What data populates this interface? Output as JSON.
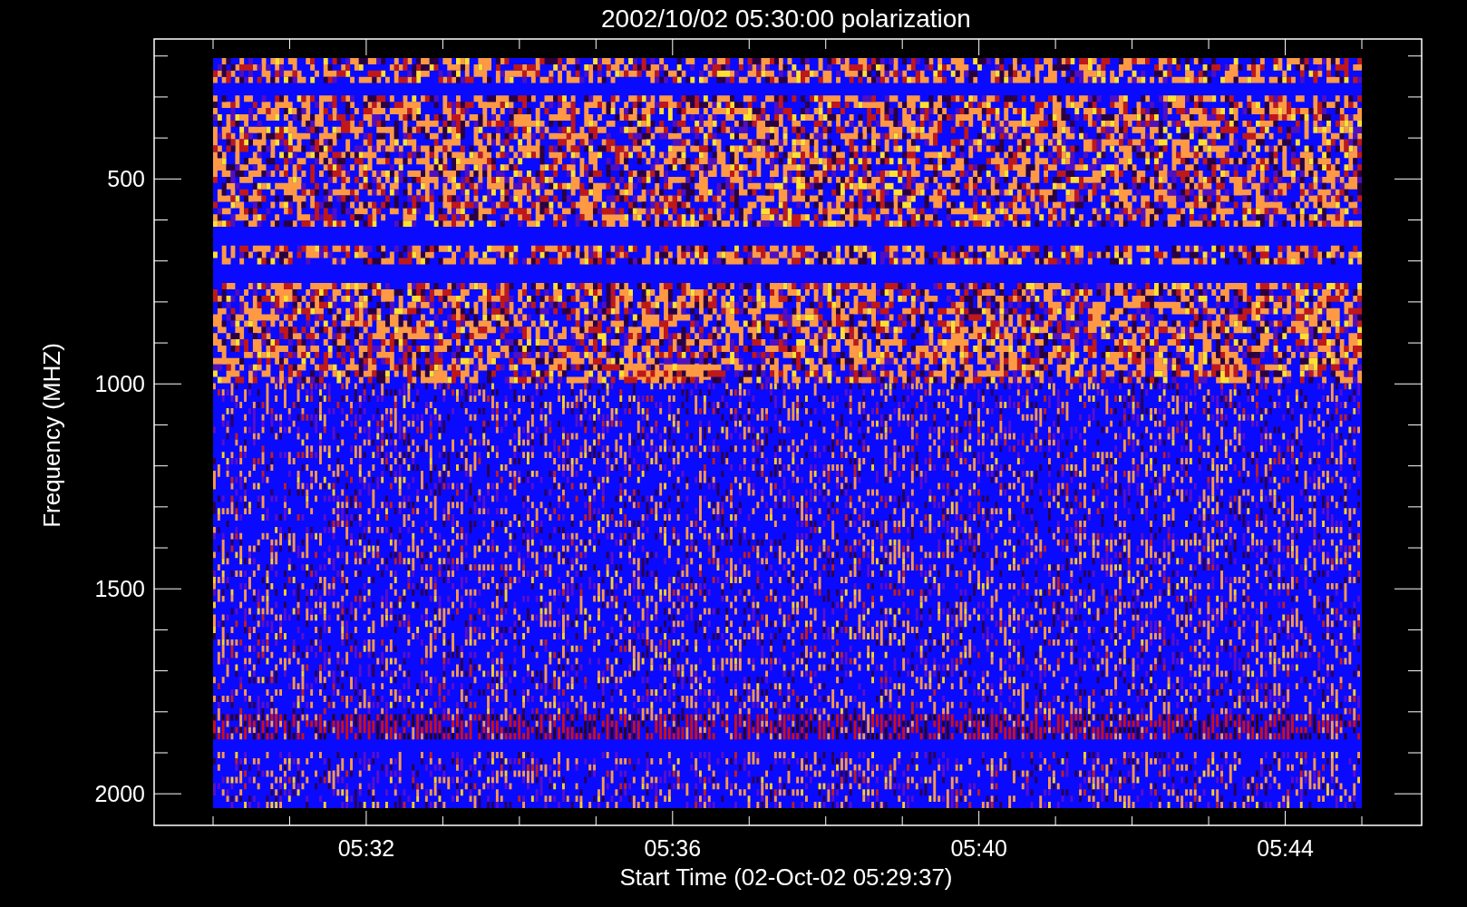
{
  "title": "2002/10/02 05:30:00 polarization",
  "y_axis": {
    "label": "Frequency (MHZ)",
    "ticks": [
      "500",
      "1000",
      "1500",
      "2000"
    ]
  },
  "x_axis": {
    "label": "Start Time (02-Oct-02 05:29:37)",
    "ticks": [
      "05:32",
      "05:36",
      "05:40",
      "05:44"
    ]
  }
}
